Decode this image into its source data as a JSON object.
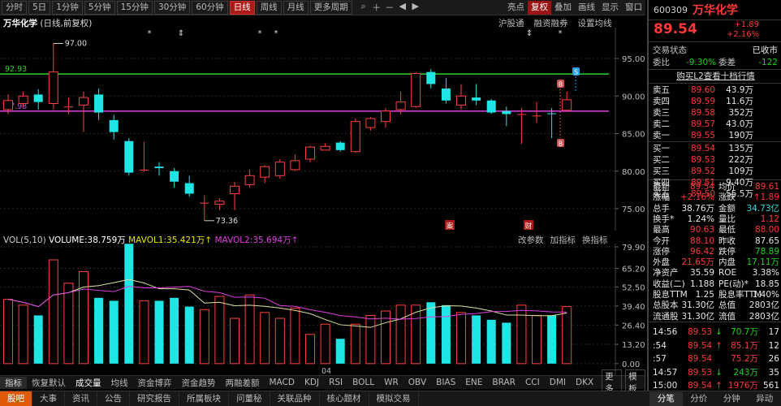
{
  "toolbar": {
    "periods": [
      "分时",
      "5日",
      "1分钟",
      "5分钟",
      "15分钟",
      "30分钟",
      "60分钟",
      "日线",
      "周线",
      "月线",
      "更多周期"
    ],
    "active_period": "日线",
    "tools": [
      "search-icon",
      "zoom-in-icon",
      "zoom-out-icon",
      "left-icon",
      "right-icon"
    ],
    "right_items": [
      "亮点",
      "复权",
      "叠加",
      "画线",
      "显示",
      "窗口"
    ],
    "active_right": "复权"
  },
  "chart": {
    "title_name": "万华化学",
    "title_mode": "(日线,前复权)",
    "links": [
      "沪股通",
      "融资融券",
      "设置均线"
    ],
    "price_axis": [
      "95.00",
      "90.00",
      "85.00",
      "80.00",
      "75.00"
    ],
    "hline_green_label": "92.93",
    "hline_magenta_label": "87.98",
    "high_annot": "97.00",
    "low_annot": "73.36",
    "markers": [
      "S",
      "B",
      "B"
    ],
    "flags": [
      "案",
      "财"
    ]
  },
  "volume": {
    "header_name": "VOL(5,10)",
    "vol_label": "VOLUME:38.759万",
    "mavol1": "MAVOL1:35.421万",
    "mavol2": "MAVOL2:35.694万",
    "links": [
      "改参数",
      "加指标",
      "换指标"
    ],
    "axis": [
      "79.90",
      "65.20",
      "52.50",
      "39.40",
      "26.40",
      "13.20",
      "0.00"
    ],
    "x_label": "04",
    "colors": {
      "up": "#ff3838",
      "down": "#1fe5e5",
      "ma1": "#e0e0a0",
      "ma2": "#e040e0"
    }
  },
  "indicator_tabs": [
    "指标",
    "恢复默认",
    "成交量",
    "均线",
    "资金博弈",
    "资金趋势",
    "两融差额",
    "MACD",
    "KDJ",
    "RSI",
    "BOLL",
    "WR",
    "OBV",
    "BIAS",
    "ENE",
    "BRAR",
    "CCI",
    "DMI",
    "DKX",
    "更多",
    "模板"
  ],
  "active_indicator": "成交量",
  "bottom_tabs": [
    "股吧",
    "大事",
    "资讯",
    "公告",
    "研究报告",
    "所属板块",
    "问董秘",
    "关联品种",
    "核心题材",
    "模拟交易"
  ],
  "active_bottom": "股吧",
  "right_tabs": [
    "分笔",
    "分价",
    "分钟",
    "异动"
  ],
  "active_right_tab": "分笔",
  "quote": {
    "code": "600309",
    "name": "万华化学",
    "price": "89.54",
    "change": "+1.89",
    "change_pct": "+2.16%",
    "status_label": "交易状态",
    "status_value": "已收市",
    "weibi_label": "委比",
    "weibi_value": "-9.30%",
    "weicha_label": "委差",
    "weicha_value": "-122",
    "level2_link": "购买L2查看十档行情",
    "asks": [
      {
        "label": "卖五",
        "price": "89.60",
        "vol": "43.9万"
      },
      {
        "label": "卖四",
        "price": "89.59",
        "vol": "11.6万"
      },
      {
        "label": "卖三",
        "price": "89.58",
        "vol": "352万"
      },
      {
        "label": "卖二",
        "price": "89.57",
        "vol": "43.0万"
      },
      {
        "label": "卖一",
        "price": "89.55",
        "vol": "190万"
      }
    ],
    "bids": [
      {
        "label": "买一",
        "price": "89.54",
        "vol": "135万"
      },
      {
        "label": "买二",
        "price": "89.53",
        "vol": "222万"
      },
      {
        "label": "买三",
        "price": "89.52",
        "vol": "109万"
      },
      {
        "label": "买四",
        "price": "89.51",
        "vol": "9.40万"
      },
      {
        "label": "买五",
        "price": "89.50",
        "vol": "55.5万"
      }
    ],
    "stats": [
      {
        "l1": "最新",
        "v1": "89.54",
        "c1": "red",
        "l2": "均价",
        "v2": "89.61",
        "c2": "red"
      },
      {
        "l1": "涨幅",
        "v1": "+2.16%",
        "c1": "red",
        "l2": "涨跌",
        "v2": "↑1.89",
        "c2": "red"
      },
      {
        "l1": "总手",
        "v1": "38.76万",
        "c1": "wht",
        "l2": "金额",
        "v2": "34.73亿",
        "c2": "cyn"
      },
      {
        "l1": "换手*",
        "v1": "1.24%",
        "c1": "wht",
        "l2": "量比",
        "v2": "1.12",
        "c2": "red"
      },
      {
        "l1": "最高",
        "v1": "90.63",
        "c1": "red",
        "l2": "最低",
        "v2": "88.00",
        "c2": "red"
      },
      {
        "l1": "今开",
        "v1": "88.10",
        "c1": "red",
        "l2": "昨收",
        "v2": "87.65",
        "c2": "wht"
      },
      {
        "l1": "涨停",
        "v1": "96.42",
        "c1": "red",
        "l2": "跌停",
        "v2": "78.89",
        "c2": "grn"
      },
      {
        "l1": "外盘",
        "v1": "21.65万",
        "c1": "red",
        "l2": "内盘",
        "v2": "17.11万",
        "c2": "grn"
      },
      {
        "l1": "净资产",
        "v1": "35.59",
        "c1": "wht",
        "l2": "ROE",
        "v2": "3.38%",
        "c2": "wht"
      },
      {
        "l1": "收益(二)",
        "v1": "1.188",
        "c1": "wht",
        "l2": "PE(动)*",
        "v2": "18.85",
        "c2": "wht"
      },
      {
        "l1": "股息TTM",
        "v1": "1.25",
        "c1": "wht",
        "l2": "股息率TTM",
        "v2": "1.40%",
        "c2": "wht"
      },
      {
        "l1": "总股本",
        "v1": "31.30亿",
        "c1": "wht",
        "l2": "总值",
        "v2": "2803亿",
        "c2": "wht"
      },
      {
        "l1": "流通股",
        "v1": "31.30亿",
        "c1": "wht",
        "l2": "流值",
        "v2": "2803亿",
        "c2": "wht"
      }
    ],
    "ticks": [
      {
        "time": "14:56",
        "price": "89.53",
        "arrow": "↓",
        "vol": "70.7万",
        "vc": "grn",
        "n": "17"
      },
      {
        "time": ":54",
        "price": "89.54",
        "arrow": "↑",
        "vol": "85.1万",
        "vc": "red",
        "n": "12"
      },
      {
        "time": ":57",
        "price": "89.54",
        "arrow": "",
        "vol": "75.2万",
        "vc": "red",
        "n": "26"
      },
      {
        "time": "14:57",
        "price": "89.53",
        "arrow": "↓",
        "vol": "243万",
        "vc": "grn",
        "n": "35"
      },
      {
        "time": "15:00",
        "price": "89.54",
        "arrow": "↑",
        "vol": "1976万",
        "vc": "red",
        "n": "561"
      }
    ]
  }
}
